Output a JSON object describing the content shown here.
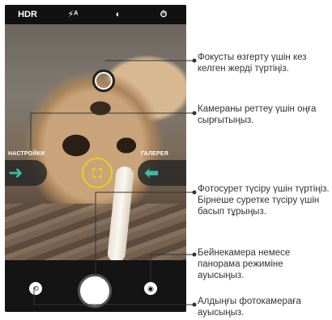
{
  "toolbar": {
    "icons": [
      "hdr-icon",
      "flash-auto-icon",
      "timer-icon-half",
      "timer-icon"
    ],
    "hdr_label": "HDR"
  },
  "viewfinder": {
    "settings_label": "НАСТРОЙКИ",
    "gallery_label": "ГАЛЕРЕЯ"
  },
  "callouts": {
    "focus": "Фокусты өзгерту үшін кез келген жерді түртіңіз.",
    "settings": "Камераны реттеу үшін оңға сырғытыңыз.",
    "shutter": "Фотосурет түсіру үшін түртіңіз. Бірнеше суретке түсіру үшін басып тұрыңыз.",
    "mode": "Бейнекамера немесе панорама режиміне ауысыңыз.",
    "front": "Алдыңғы фотокамераға ауысыңыз."
  },
  "colors": {
    "accent_teal": "#3fb8a6",
    "focus_yellow": "#e2d21d",
    "callout_line": "#333333"
  }
}
